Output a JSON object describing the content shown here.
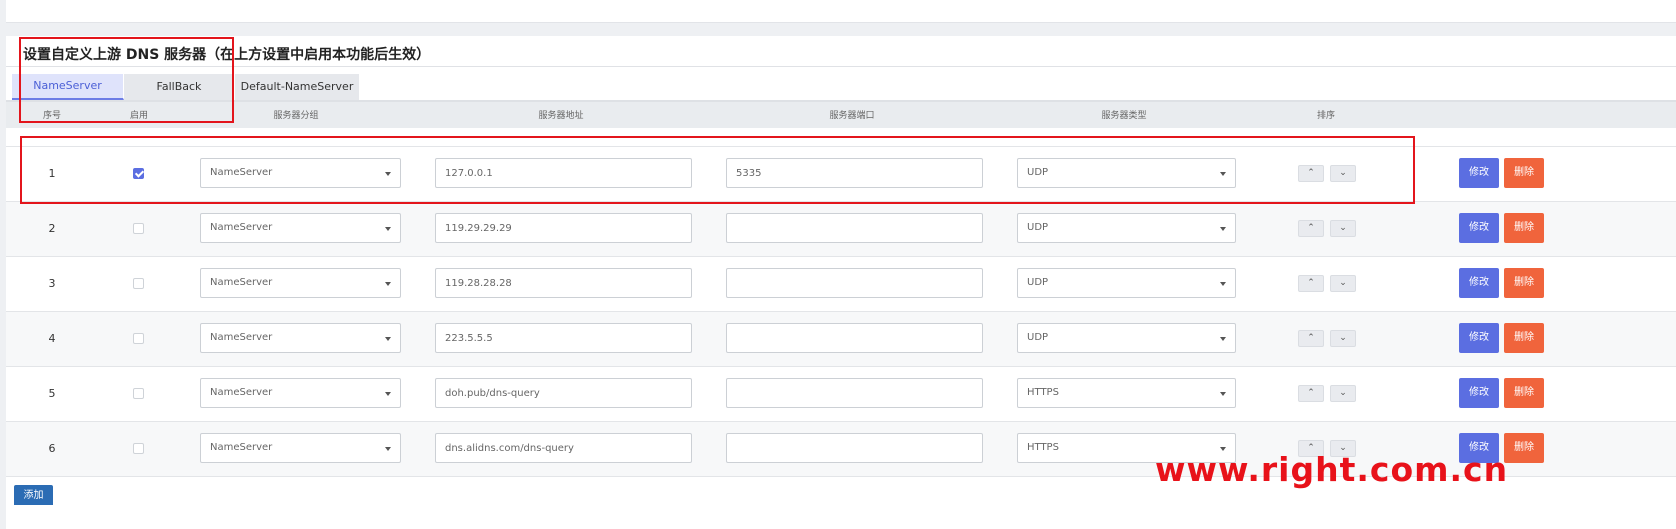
{
  "section": {
    "title": "设置自定义上游 DNS 服务器（在上方设置中启用本功能后生效）"
  },
  "tabs": [
    {
      "label": "NameServer",
      "active": true
    },
    {
      "label": "FallBack",
      "active": false
    },
    {
      "label": "Default-NameServer",
      "active": false
    }
  ],
  "table": {
    "headers": {
      "index": "序号",
      "enabled": "启用",
      "group": "服务器分组",
      "address": "服务器地址",
      "port": "服务器端口",
      "type": "服务器类型",
      "sort": "排序"
    },
    "rows": [
      {
        "index": "1",
        "enabled": true,
        "group": "NameServer",
        "address": "127.0.0.1",
        "port": "5335",
        "type": "UDP"
      },
      {
        "index": "2",
        "enabled": false,
        "group": "NameServer",
        "address": "119.29.29.29",
        "port": "",
        "type": "UDP"
      },
      {
        "index": "3",
        "enabled": false,
        "group": "NameServer",
        "address": "119.28.28.28",
        "port": "",
        "type": "UDP"
      },
      {
        "index": "4",
        "enabled": false,
        "group": "NameServer",
        "address": "223.5.5.5",
        "port": "",
        "type": "UDP"
      },
      {
        "index": "5",
        "enabled": false,
        "group": "NameServer",
        "address": "doh.pub/dns-query",
        "port": "",
        "type": "HTTPS"
      },
      {
        "index": "6",
        "enabled": false,
        "group": "NameServer",
        "address": "dns.alidns.com/dns-query",
        "port": "",
        "type": "HTTPS"
      }
    ],
    "actions": {
      "edit": "修改",
      "delete": "删除"
    }
  },
  "add_button": "添加",
  "watermark": "www.right.com.cn",
  "colors": {
    "primary": "#5b6ee1",
    "danger": "#f0643c",
    "highlight": "#e3151c"
  }
}
